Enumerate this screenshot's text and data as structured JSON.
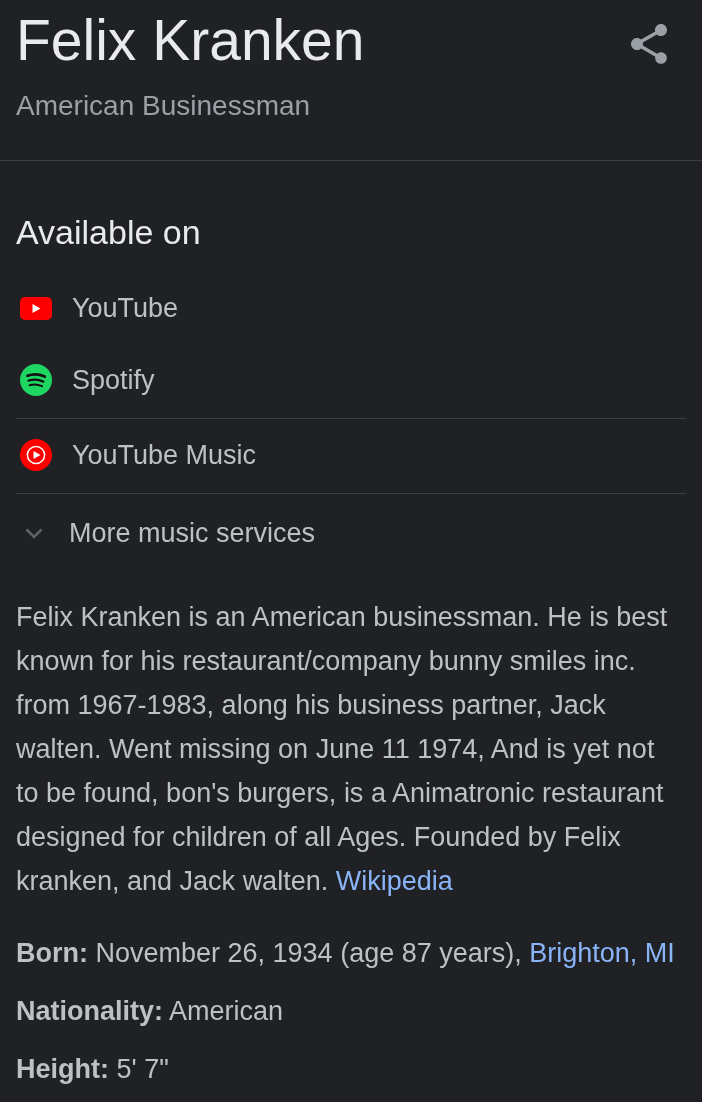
{
  "header": {
    "title": "Felix Kranken",
    "subtitle": "American Businessman"
  },
  "available_on": {
    "heading": "Available on",
    "service_groups": [
      {
        "services": [
          {
            "name": "YouTube",
            "kind": "youtube"
          },
          {
            "name": "Spotify",
            "kind": "spotify"
          }
        ]
      },
      {
        "services": [
          {
            "name": "YouTube Music",
            "kind": "youtube_music"
          }
        ]
      }
    ],
    "more": {
      "label": "More music services",
      "expanded": false
    }
  },
  "description": {
    "text": "Felix Kranken is an American businessman. He is best known for his restaurant/company bunny smiles inc. from 1967-1983, along his business partner, Jack walten. Went missing on June 11 1974, And is yet not to be found, bon's burgers, is a Animatronic restaurant designed for children of all Ages. Founded by Felix kranken, and Jack walten.",
    "link": "Wikipedia"
  },
  "facts": [
    {
      "label": "Born:",
      "value": "November 26, 1934 (age 87 years),",
      "link": "Brighton, MI"
    },
    {
      "label": "Nationality:",
      "value": "American"
    },
    {
      "label": "Height:",
      "value": "5' 7\""
    }
  ]
}
